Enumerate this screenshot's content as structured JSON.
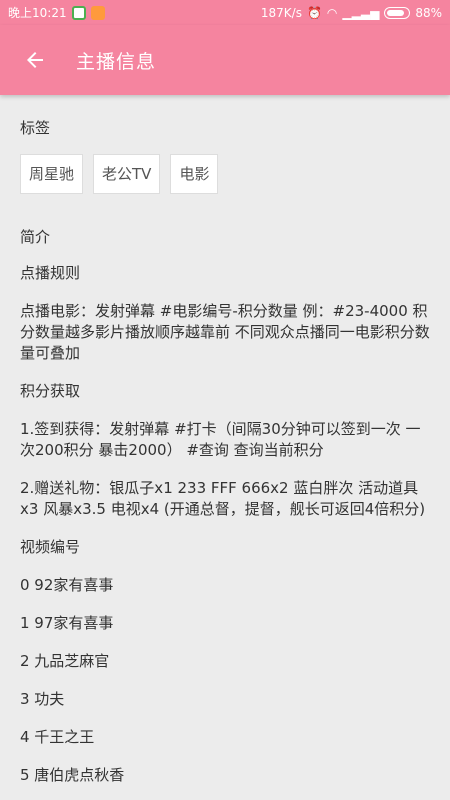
{
  "status_bar": {
    "time": "晚上10:21",
    "speed": "187K/s",
    "battery": "88%",
    "battery_level": 0.88,
    "icons": [
      "app-icon-1",
      "app-icon-2",
      "alarm-icon",
      "wifi-icon",
      "signal-icon",
      "battery-icon"
    ]
  },
  "appbar": {
    "title": "主播信息",
    "back_icon": "arrow-left-icon",
    "color": "#f5849f"
  },
  "tags_section": {
    "label": "标签",
    "tags": [
      "周星驰",
      "老公TV",
      "电影"
    ]
  },
  "intro": {
    "title": "简介",
    "paragraphs": [
      "点播规则",
      "点播电影：发射弹幕 #电影编号-积分数量 例：#23-4000 积分数量越多影片播放顺序越靠前 不同观众点播同一电影积分数量可叠加",
      "积分获取",
      "1.签到获得：发射弹幕 #打卡（间隔30分钟可以签到一次 一次200积分 暴击2000） #查询 查询当前积分",
      "2.赠送礼物：银瓜子x1  233 FFF 666x2  蓝白胖次 活动道具x3  风暴x3.5 电视x4 (开通总督，提督，舰长可返回4倍积分)",
      "视频编号"
    ],
    "videos": [
      "0 92家有喜事",
      "1 97家有喜事",
      "2 九品芝麻官",
      "3 功夫",
      "4 千王之王",
      "5 唐伯虎点秋香"
    ]
  }
}
